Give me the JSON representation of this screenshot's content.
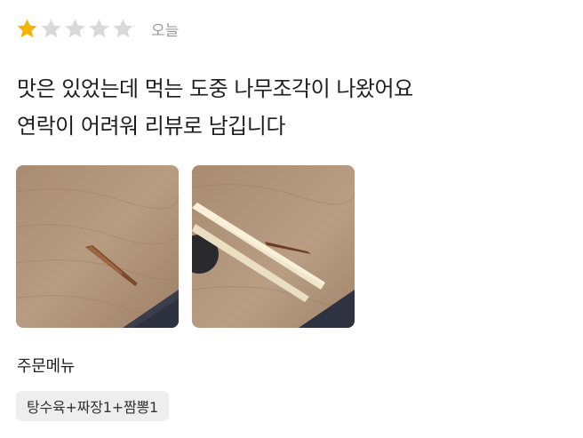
{
  "review": {
    "rating": 1,
    "max_rating": 5,
    "star_color_filled": "#F5B400",
    "star_color_empty": "#D9D9D9",
    "date": "오늘",
    "text_lines": [
      "맛은 있었는데 먹는 도중 나무조각이 나왔어요",
      "연락이 어려워 리뷰로 남깁니다"
    ],
    "photos": [
      {
        "icon": "wood-splinter-photo"
      },
      {
        "icon": "chopsticks-splinter-photo"
      }
    ]
  },
  "order": {
    "menu_label": "주문메뉴",
    "menu_items": "탕수육+짜장1+짬뽕1"
  }
}
